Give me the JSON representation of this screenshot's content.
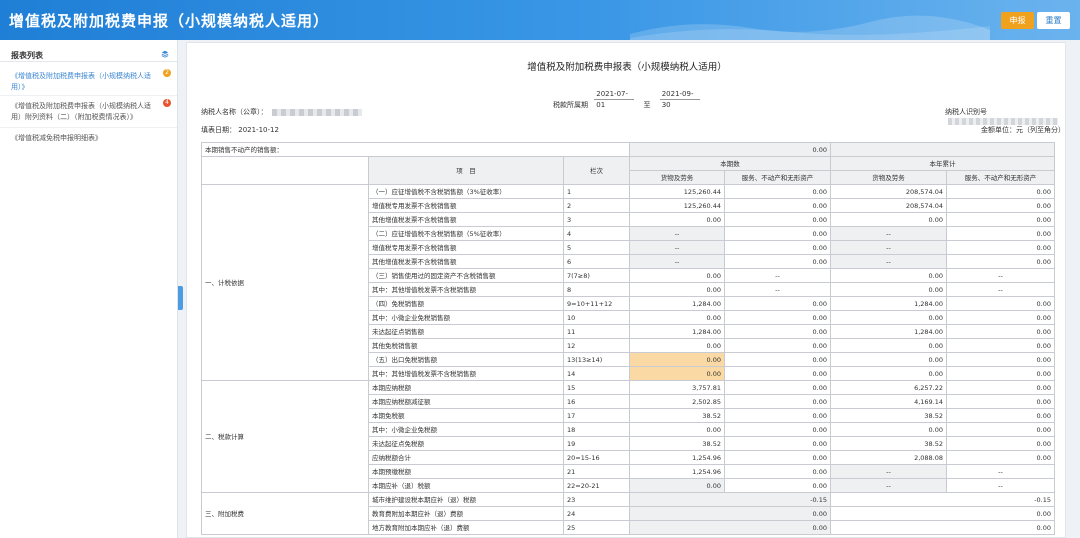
{
  "header": {
    "title": "增值税及附加税费申报（小规模纳税人适用）",
    "submit_label": "申报",
    "reset_label": "重置"
  },
  "sidebar": {
    "title": "报表列表",
    "items": [
      {
        "label": "《增值税及附加税费申报表（小规模纳税人适用）》",
        "badge": "2",
        "active": true
      },
      {
        "label": "《增值税及附加税费申报表（小规模纳税人适用）附列资料（二）（附加税费情况表）》",
        "badge": "4",
        "active": false
      },
      {
        "label": "《增值税减免税申报明细表》",
        "badge": "",
        "active": false
      }
    ]
  },
  "document": {
    "title": "增值税及附加税费申报表（小规模纳税人适用）",
    "period_label": "税款所属期",
    "period_start": "2021-07-01",
    "period_to": "至",
    "period_end": "2021-09-30",
    "taxpayer_name_label": "纳税人名称（公章）：",
    "taxpayer_id_label": "纳税人识别号",
    "filing_date_label": "填表日期：",
    "filing_date": "2021-10-12",
    "unit_label": "金额单位：元（列至角分）"
  },
  "table": {
    "prefill_label": "本期销售不动产的销售额：",
    "prefill_value": "0.00",
    "h_item": "项　目",
    "h_col": "栏次",
    "h_current": "本期数",
    "h_ytd": "本年累计",
    "h_goods": "货物及劳务",
    "h_services": "服务、不动产和无形资产",
    "sections": [
      "一、计税依据",
      "二、税款计算",
      "三、附加税费"
    ],
    "rows": [
      {
        "item": "（一）应征增值税不含税销售额（3%征收率）",
        "col": "1",
        "c1": "125,260.44",
        "c2": "0.00",
        "c3": "208,574.04",
        "c4": "0.00"
      },
      {
        "item": "增值税专用发票不含税销售额",
        "col": "2",
        "c1": "125,260.44",
        "c2": "0.00",
        "c3": "208,574.04",
        "c4": "0.00"
      },
      {
        "item": "其他增值税发票不含税销售额",
        "col": "3",
        "c1": "0.00",
        "c2": "0.00",
        "c3": "0.00",
        "c4": "0.00"
      },
      {
        "item": "（二）应征增值税不含税销售额（5%征收率）",
        "col": "4",
        "c1": "--",
        "c2": "0.00",
        "c3": "--",
        "c4": "0.00"
      },
      {
        "item": "增值税专用发票不含税销售额",
        "col": "5",
        "c1": "--",
        "c2": "0.00",
        "c3": "--",
        "c4": "0.00"
      },
      {
        "item": "其他增值税发票不含税销售额",
        "col": "6",
        "c1": "--",
        "c2": "0.00",
        "c3": "--",
        "c4": "0.00"
      },
      {
        "item": "（三）销售使用过的固定资产不含税销售额",
        "col": "7(7≥8)",
        "c1": "0.00",
        "c2": "--",
        "c3": "0.00",
        "c4": "--"
      },
      {
        "item": "其中：其他增值税发票不含税销售额",
        "col": "8",
        "c1": "0.00",
        "c2": "--",
        "c3": "0.00",
        "c4": "--"
      },
      {
        "item": "（四）免税销售额",
        "col": "9=10+11+12",
        "c1": "1,284.00",
        "c2": "0.00",
        "c3": "1,284.00",
        "c4": "0.00"
      },
      {
        "item": "其中：小微企业免税销售额",
        "col": "10",
        "c1": "0.00",
        "c2": "0.00",
        "c3": "0.00",
        "c4": "0.00"
      },
      {
        "item": "未达起征点销售额",
        "col": "11",
        "c1": "1,284.00",
        "c2": "0.00",
        "c3": "1,284.00",
        "c4": "0.00"
      },
      {
        "item": "其他免税销售额",
        "col": "12",
        "c1": "0.00",
        "c2": "0.00",
        "c3": "0.00",
        "c4": "0.00"
      },
      {
        "item": "（五）出口免税销售额",
        "col": "13(13≥14)",
        "c1": "0.00",
        "c2": "0.00",
        "c3": "0.00",
        "c4": "0.00"
      },
      {
        "item": "其中：其他增值税发票不含税销售额",
        "col": "14",
        "c1": "0.00",
        "c2": "0.00",
        "c3": "0.00",
        "c4": "0.00"
      },
      {
        "item": "本期应纳税额",
        "col": "15",
        "c1": "3,757.81",
        "c2": "0.00",
        "c3": "6,257.22",
        "c4": "0.00"
      },
      {
        "item": "本期应纳税额减征额",
        "col": "16",
        "c1": "2,502.85",
        "c2": "0.00",
        "c3": "4,169.14",
        "c4": "0.00"
      },
      {
        "item": "本期免税额",
        "col": "17",
        "c1": "38.52",
        "c2": "0.00",
        "c3": "38.52",
        "c4": "0.00"
      },
      {
        "item": "其中：小微企业免税额",
        "col": "18",
        "c1": "0.00",
        "c2": "0.00",
        "c3": "0.00",
        "c4": "0.00"
      },
      {
        "item": "未达起征点免税额",
        "col": "19",
        "c1": "38.52",
        "c2": "0.00",
        "c3": "38.52",
        "c4": "0.00"
      },
      {
        "item": "应纳税额合计",
        "col": "20=15-16",
        "c1": "1,254.96",
        "c2": "0.00",
        "c3": "2,088.08",
        "c4": "0.00"
      },
      {
        "item": "本期预缴税额",
        "col": "21",
        "c1": "1,254.96",
        "c2": "0.00",
        "c3": "--",
        "c4": "--"
      },
      {
        "item": "本期应补（退）税额",
        "col": "22=20-21",
        "c1": "0.00",
        "c2": "0.00",
        "c3": "--",
        "c4": "--"
      },
      {
        "item": "城市维护建设税本期应补（退）税额",
        "col": "23",
        "c1": "",
        "c2": "-0.15",
        "c3": "",
        "c4": "-0.15"
      },
      {
        "item": "教育费附加本期应补（退）费额",
        "col": "24",
        "c1": "",
        "c2": "0.00",
        "c3": "",
        "c4": "0.00"
      },
      {
        "item": "地方教育附加本期应补（退）费额",
        "col": "25",
        "c1": "",
        "c2": "0.00",
        "c3": "",
        "c4": "0.00"
      }
    ]
  },
  "colors": {
    "accent": "#1f7fd6",
    "orange": "#f0a11e",
    "input_highlight": "#fbd9a4",
    "readonly": "#eef0f2"
  }
}
